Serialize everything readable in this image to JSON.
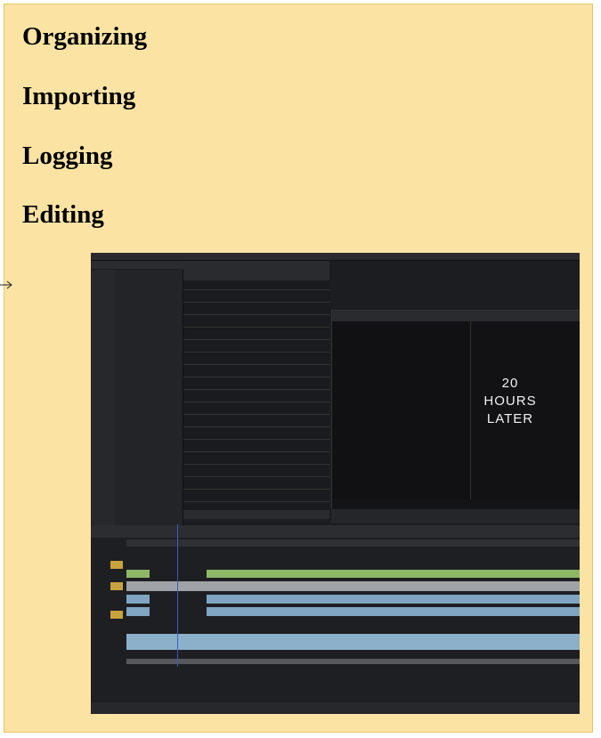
{
  "headings": [
    "Organizing",
    "Importing",
    "Logging",
    "Editing"
  ],
  "screenshot": {
    "viewer_frame_text": [
      "20 HOURS",
      "LATER"
    ]
  },
  "colors": {
    "card_bg": "#fbe3a4",
    "card_border": "#e9c469",
    "app_bg": "#1c1d20",
    "audio_track": "#8fb866",
    "video_track": "#7fa5c2",
    "playhead": "#3b5cd0"
  },
  "icons": [
    "arrow-right-icon"
  ]
}
